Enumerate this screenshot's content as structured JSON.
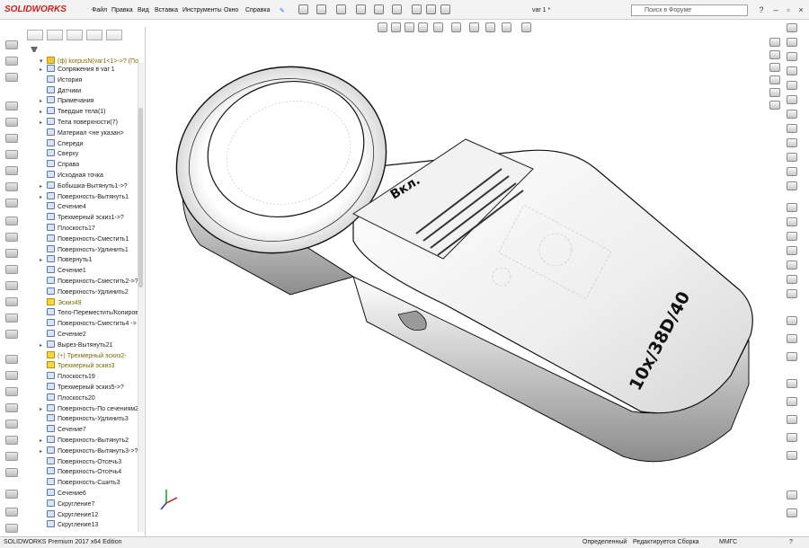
{
  "app": {
    "logo": "SOLIDWORKS",
    "doc_title": "var 1 *"
  },
  "menu": [
    "Файл",
    "Правка",
    "Вид",
    "Вставка",
    "Инструменты",
    "Окно",
    "Справка"
  ],
  "search": {
    "placeholder": "Поиск в Форуме"
  },
  "tree": {
    "root": "(ф) korpusN(var1<1>->? (По",
    "items": [
      {
        "label": "Сопряжения в var 1",
        "exp": "▸",
        "warn": false
      },
      {
        "label": "История",
        "exp": "",
        "warn": false
      },
      {
        "label": "Датчики",
        "exp": "",
        "warn": false
      },
      {
        "label": "Примечания",
        "exp": "▸",
        "warn": false
      },
      {
        "label": "Твердые тела(1)",
        "exp": "▸",
        "warn": false
      },
      {
        "label": "Тела поверхности(7)",
        "exp": "▸",
        "warn": false
      },
      {
        "label": "Материал <не указан>",
        "exp": "",
        "warn": false
      },
      {
        "label": "Спереди",
        "exp": "",
        "warn": false
      },
      {
        "label": "Сверху",
        "exp": "",
        "warn": false
      },
      {
        "label": "Справа",
        "exp": "",
        "warn": false
      },
      {
        "label": "Исходная точка",
        "exp": "",
        "warn": false
      },
      {
        "label": "Бобышка-Вытянуть1->?",
        "exp": "▸",
        "warn": false
      },
      {
        "label": "Поверхность-Вытянуть1",
        "exp": "▸",
        "warn": false
      },
      {
        "label": "Сечение4",
        "exp": "",
        "warn": false
      },
      {
        "label": "Трехмерный эскиз1->?",
        "exp": "",
        "warn": false
      },
      {
        "label": "Плоскость17",
        "exp": "",
        "warn": false
      },
      {
        "label": "Поверхность-Сместить1",
        "exp": "",
        "warn": false
      },
      {
        "label": "Поверхность-Удлинить1",
        "exp": "",
        "warn": false
      },
      {
        "label": "Повернуть1",
        "exp": "▸",
        "warn": false
      },
      {
        "label": "Сечение1",
        "exp": "",
        "warn": false
      },
      {
        "label": "Поверхность-Сместить2->?",
        "exp": "",
        "warn": false
      },
      {
        "label": "Поверхность-Удлинить2",
        "exp": "",
        "warn": false
      },
      {
        "label": "Эскиз49",
        "exp": "",
        "warn": true
      },
      {
        "label": "Тело-Переместить/Копиров",
        "exp": "",
        "warn": false
      },
      {
        "label": "Поверхность-Сместить4 ->",
        "exp": "",
        "warn": false
      },
      {
        "label": "Сечение2",
        "exp": "",
        "warn": false
      },
      {
        "label": "Вырез-Вытянуть21",
        "exp": "▸",
        "warn": false
      },
      {
        "label": "(+) Трехмерный эскиз2-",
        "exp": "",
        "warn": true
      },
      {
        "label": "Трехмерный эскиз3",
        "exp": "",
        "warn": true
      },
      {
        "label": "Плоскость19",
        "exp": "",
        "warn": false
      },
      {
        "label": "Трехмерный эскиз5->?",
        "exp": "",
        "warn": false
      },
      {
        "label": "Плоскость20",
        "exp": "",
        "warn": false
      },
      {
        "label": "Поверхность-По сечениям2",
        "exp": "▸",
        "warn": false
      },
      {
        "label": "Поверхность-Удлинить3",
        "exp": "",
        "warn": false
      },
      {
        "label": "Сечение7",
        "exp": "",
        "warn": false
      },
      {
        "label": "Поверхность-Вытянуть2",
        "exp": "▸",
        "warn": false
      },
      {
        "label": "Поверхность-Вытянуть3->?",
        "exp": "▸",
        "warn": false
      },
      {
        "label": "Поверхность-Отсечь3",
        "exp": "",
        "warn": false
      },
      {
        "label": "Поверхность-Отсечь4",
        "exp": "",
        "warn": false
      },
      {
        "label": "Поверхность-Сшить3",
        "exp": "",
        "warn": false
      },
      {
        "label": "Сечение6",
        "exp": "",
        "warn": false
      },
      {
        "label": "Скругление7",
        "exp": "",
        "warn": false
      },
      {
        "label": "Скругление12",
        "exp": "",
        "warn": false
      },
      {
        "label": "Скругление13",
        "exp": "",
        "warn": false
      }
    ]
  },
  "model": {
    "button_label": "Вкл.",
    "side_label": "10x/38D/40"
  },
  "status": {
    "edition": "SOLIDWORKS Premium 2017 x64 Edition",
    "defined": "Определенный",
    "editing": "Редактируется Сборка",
    "units": "ММГС"
  }
}
